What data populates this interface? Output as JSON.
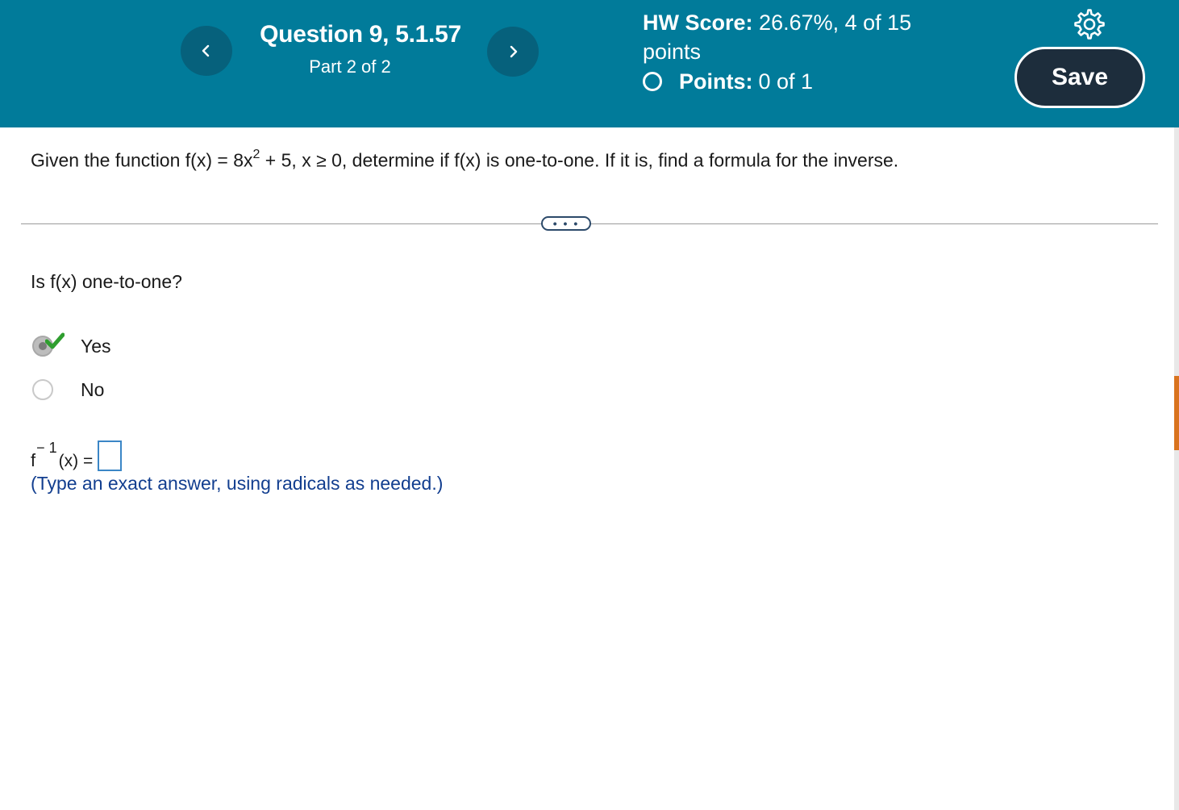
{
  "header": {
    "question_title": "Question 9, 5.1.57",
    "part_label": "Part 2 of 2",
    "hw_score_label": "HW Score:",
    "hw_score_value": "26.67%, 4 of 15",
    "hw_score_unit": "points",
    "points_label": "Points:",
    "points_value": "0 of 1",
    "save_label": "Save",
    "prev_icon": "chevron-left-icon",
    "next_icon": "chevron-right-icon",
    "settings_icon": "gear-icon"
  },
  "question": {
    "prompt_pre": "Given the function f(x) = 8x",
    "prompt_exp": "2",
    "prompt_post": " + 5, x ≥ 0, determine if f(x) is one-to-one. If it is, find a formula for the inverse.",
    "more_label": "• • •",
    "sub_question": "Is f(x) one-to-one?",
    "options": [
      {
        "label": "Yes",
        "selected": true,
        "correct": true
      },
      {
        "label": "No",
        "selected": false
      }
    ],
    "inverse_f": "f",
    "inverse_sup": "− 1",
    "inverse_rest": "(x) =",
    "inverse_answer": "",
    "hint": "(Type an exact answer, using radicals as needed.)"
  },
  "colors": {
    "header_bg": "#017b9a",
    "nav_button_bg": "#06617c",
    "save_bg": "#1d2d3c",
    "hint_text": "#123e8f",
    "check_green": "#2f9e2f",
    "answer_box_border": "#3b86c6"
  }
}
